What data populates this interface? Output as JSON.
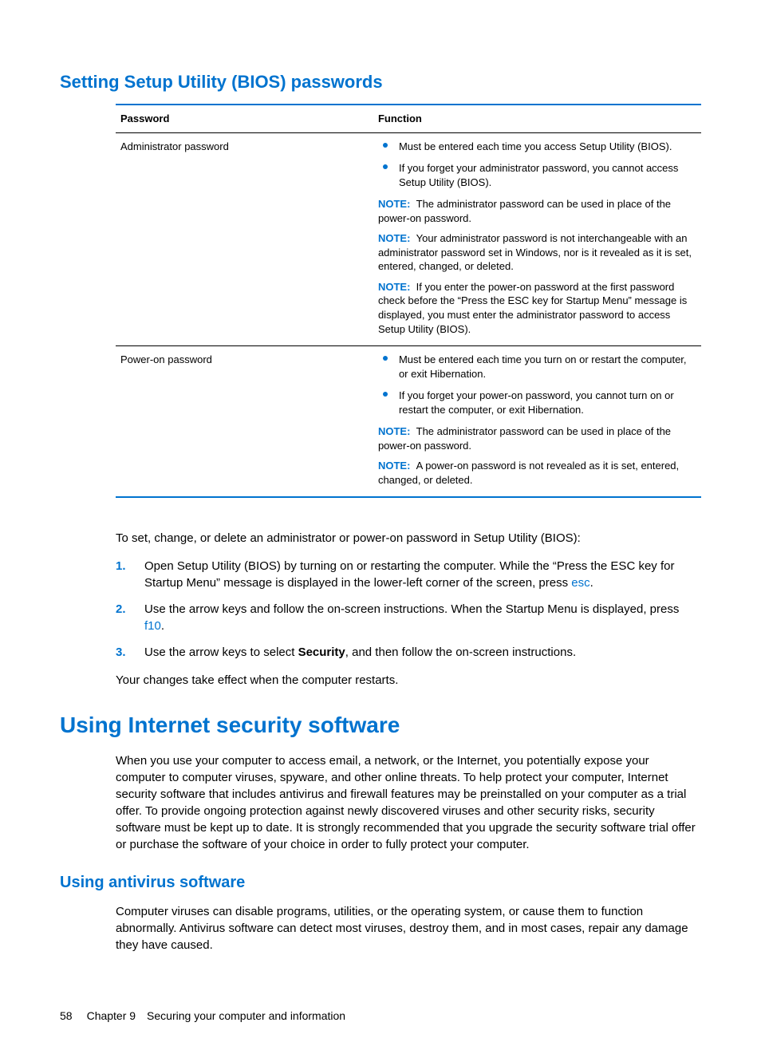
{
  "headings": {
    "h2_bios": "Setting Setup Utility (BIOS) passwords",
    "h1_security": "Using Internet security software",
    "h3_antivirus": "Using antivirus software"
  },
  "table": {
    "header_password": "Password",
    "header_function": "Function",
    "rows": [
      {
        "password": "Administrator password",
        "bullets": [
          "Must be entered each time you access Setup Utility (BIOS).",
          "If you forget your administrator password, you cannot access Setup Utility (BIOS)."
        ],
        "notes": [
          "The administrator password can be used in place of the power-on password.",
          "Your administrator password is not interchangeable with an administrator password set in Windows, nor is it revealed as it is set, entered, changed, or deleted.",
          "If you enter the power-on password at the first password check before the “Press the ESC key for Startup Menu” message is displayed, you must enter the administrator password to access Setup Utility (BIOS)."
        ]
      },
      {
        "password": "Power-on password",
        "bullets": [
          "Must be entered each time you turn on or restart the computer, or exit Hibernation.",
          "If you forget your power-on password, you cannot turn on or restart the computer, or exit Hibernation."
        ],
        "notes": [
          "The administrator password can be used in place of the power-on password.",
          "A power-on password is not revealed as it is set, entered, changed, or deleted."
        ]
      }
    ],
    "note_label": "NOTE:"
  },
  "intro_text": "To set, change, or delete an administrator or power-on password in Setup Utility (BIOS):",
  "steps": {
    "s1a": "Open Setup Utility (BIOS) by turning on or restarting the computer. While the “Press the ESC key for Startup Menu” message is displayed in the lower-left corner of the screen, press ",
    "s1k": "esc",
    "s1b": ".",
    "s2a": "Use the arrow keys and follow the on-screen instructions. When the Startup Menu is displayed, press ",
    "s2k": "f10",
    "s2b": ".",
    "s3a": "Use the arrow keys to select ",
    "s3bold": "Security",
    "s3b": ", and then follow the on-screen instructions."
  },
  "after_steps": "Your changes take effect when the computer restarts.",
  "security_para": "When you use your computer to access email, a network, or the Internet, you potentially expose your computer to computer viruses, spyware, and other online threats. To help protect your computer, Internet security software that includes antivirus and firewall features may be preinstalled on your computer as a trial offer. To provide ongoing protection against newly discovered viruses and other security risks, security software must be kept up to date. It is strongly recommended that you upgrade the security software trial offer or purchase the software of your choice in order to fully protect your computer.",
  "antivirus_para": "Computer viruses can disable programs, utilities, or the operating system, or cause them to function abnormally. Antivirus software can detect most viruses, destroy them, and in most cases, repair any damage they have caused.",
  "footer": {
    "page_num": "58",
    "chapter": "Chapter 9 Securing your computer and information"
  }
}
